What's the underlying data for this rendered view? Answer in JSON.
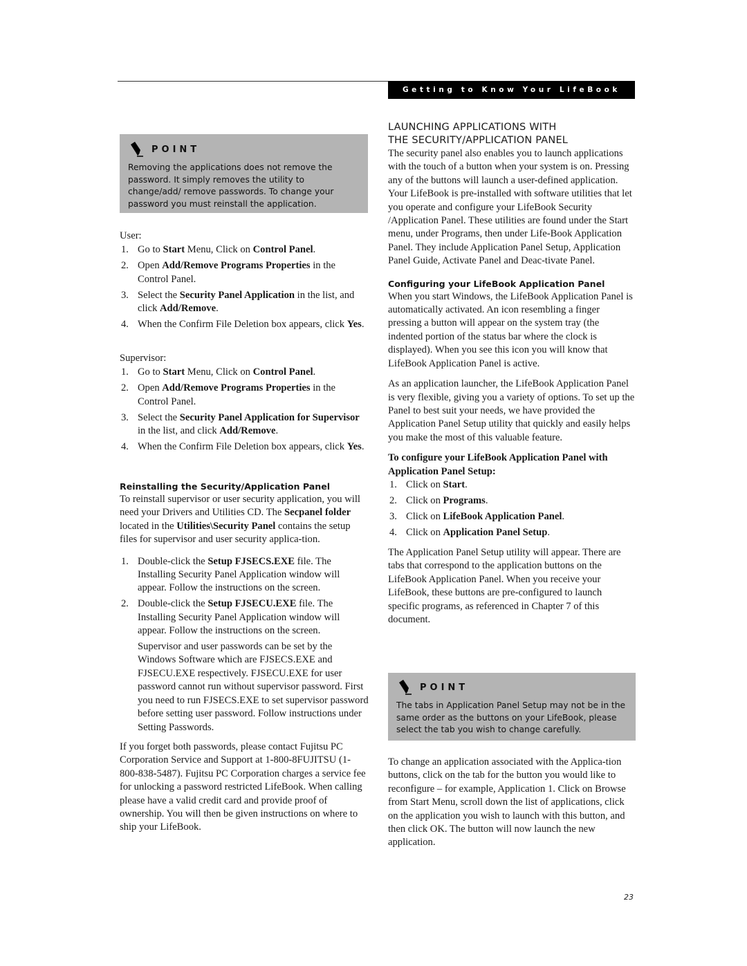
{
  "header": {
    "section_title": "Getting to Know Your LifeBook"
  },
  "left_column": {
    "point_box": {
      "label": "POINT",
      "icon": "pencil-icon",
      "text": "Removing the applications does not remove the password. It simply removes the utility to change/add/ remove passwords. To change your password you must reinstall the application."
    },
    "user": {
      "heading": "User:",
      "steps": [
        {
          "num": "1.",
          "parts": [
            [
              "Go to ",
              0
            ],
            [
              "Start",
              1
            ],
            [
              " Menu, Click on ",
              0
            ],
            [
              "Control Panel",
              1
            ],
            [
              ".",
              0
            ]
          ]
        },
        {
          "num": "2.",
          "parts": [
            [
              "Open ",
              0
            ],
            [
              "Add/Remove Programs Properties",
              1
            ],
            [
              " in the Control Panel.",
              0
            ]
          ]
        },
        {
          "num": "3.",
          "parts": [
            [
              "Select the ",
              0
            ],
            [
              "Security Panel Application",
              1
            ],
            [
              " in the list, and click ",
              0
            ],
            [
              "Add/Remove",
              1
            ],
            [
              ".",
              0
            ]
          ]
        },
        {
          "num": "4.",
          "parts": [
            [
              "When the Confirm File Deletion box appears, click ",
              0
            ],
            [
              "Yes",
              1
            ],
            [
              ".",
              0
            ]
          ]
        }
      ]
    },
    "supervisor": {
      "heading": "Supervisor:",
      "steps": [
        {
          "num": "1.",
          "parts": [
            [
              "Go to ",
              0
            ],
            [
              "Start",
              1
            ],
            [
              " Menu, Click on ",
              0
            ],
            [
              "Control Panel",
              1
            ],
            [
              ".",
              0
            ]
          ]
        },
        {
          "num": "2.",
          "parts": [
            [
              "Open ",
              0
            ],
            [
              "Add/Remove Programs Properties",
              1
            ],
            [
              " in the Control Panel.",
              0
            ]
          ]
        },
        {
          "num": "3.",
          "parts": [
            [
              "Select the ",
              0
            ],
            [
              "Security Panel Application for Supervisor",
              1
            ],
            [
              " in the list, and click ",
              0
            ],
            [
              "Add/Remove",
              1
            ],
            [
              ".",
              0
            ]
          ]
        },
        {
          "num": "4.",
          "parts": [
            [
              "When the Confirm File Deletion box appears, click ",
              0
            ],
            [
              "Yes",
              1
            ],
            [
              ".",
              0
            ]
          ]
        }
      ]
    },
    "reinstall": {
      "heading": "Reinstalling the Security/Application Panel",
      "intro_parts": [
        [
          "To reinstall supervisor or user security application, you will need your Drivers and Utilities CD. The ",
          0
        ],
        [
          "Secpanel folder",
          1
        ],
        [
          " located in the ",
          0
        ],
        [
          "Utilities\\Security Panel",
          1
        ],
        [
          " contains the setup files for supervisor and user security applica-tion.",
          0
        ]
      ],
      "steps": [
        {
          "num": "1.",
          "parts": [
            [
              "Double-click the ",
              0
            ],
            [
              "Setup FJSECS.EXE",
              1
            ],
            [
              " file. The Installing Security Panel Application window will appear. Follow the instructions on the screen.",
              0
            ]
          ]
        },
        {
          "num": "2.",
          "parts": [
            [
              "Double-click the ",
              0
            ],
            [
              "Setup FJSECU.EXE",
              1
            ],
            [
              " file. The Installing Security Panel Application window will appear. Follow the instructions on the screen.",
              0
            ]
          ]
        }
      ],
      "note": "Supervisor and user passwords can be set by the Windows Software which are FJSECS.EXE and FJSECU.EXE respectively. FJSECU.EXE for user password cannot run without supervisor password. First you need to run FJSECS.EXE to set supervisor password before setting user password. Follow instructions under Setting Passwords.",
      "contact": "If you forget both passwords, please contact Fujitsu PC Corporation Service and Support at 1-800-8FUJITSU (1-800-838-5487).  Fujitsu PC Corporation charges a service fee for unlocking a password restricted LifeBook. When calling please have a valid credit card and provide proof of ownership. You will then be given instructions on where to ship your LifeBook."
    }
  },
  "right_column": {
    "main_heading_line1": "LAUNCHING APPLICATIONS WITH",
    "main_heading_line2": "THE SECURITY/APPLICATION PANEL",
    "intro": "The security panel also enables you to launch applications with the touch of a button when your system is on. Pressing any of the buttons will launch a user-defined application. Your LifeBook is pre-installed with software utilities that let you operate and configure your LifeBook Security /Application Panel. These utilities are found under the Start menu, under Programs, then under Life-Book Application Panel. They include Application Panel Setup, Application Panel Guide, Activate Panel and Deac-tivate Panel.",
    "configuring": {
      "heading": "Configuring your LifeBook Application Panel",
      "para1": "When you start Windows, the LifeBook Application Panel is automatically activated. An icon resembling a finger pressing a button will appear on the system tray (the indented portion of the status bar where the clock is displayed). When you see this icon you will know that LifeBook Application Panel is active.",
      "para2": "As an application launcher, the LifeBook Application Panel is very flexible, giving you a variety of options. To set up the Panel to best suit your needs, we have provided the Application Panel Setup utility that quickly and easily helps you make the most of this valuable feature.",
      "steps_heading": "To configure your LifeBook Application Panel with Application Panel Setup:",
      "steps": [
        {
          "num": "1.",
          "parts": [
            [
              "Click on ",
              0
            ],
            [
              "Start",
              1
            ],
            [
              ".",
              0
            ]
          ]
        },
        {
          "num": "2.",
          "parts": [
            [
              "Click on ",
              0
            ],
            [
              "Programs",
              1
            ],
            [
              ".",
              0
            ]
          ]
        },
        {
          "num": "3.",
          "parts": [
            [
              "Click on ",
              0
            ],
            [
              "LifeBook Application Panel",
              1
            ],
            [
              ".",
              0
            ]
          ]
        },
        {
          "num": "4.",
          "parts": [
            [
              "Click on ",
              0
            ],
            [
              "Application Panel Setup",
              1
            ],
            [
              ".",
              0
            ]
          ]
        }
      ],
      "para3": "The Application Panel Setup utility will appear. There are tabs that correspond to the application buttons on the LifeBook Application Panel.  When you receive your LifeBook, these buttons are pre-configured to launch specific programs, as referenced in Chapter 7 of this document."
    },
    "point_box": {
      "label": "POINT",
      "icon": "pencil-icon",
      "text": "The tabs in Application Panel Setup may not be in the same order as the buttons on your LifeBook, please select the tab you wish to change carefully."
    },
    "closing": "To change an application associated with the Applica-tion buttons, click on the tab for the button you would like to reconfigure – for example, Application 1. Click on Browse from Start Menu, scroll down the list of applications, click on the application you wish to launch with this button, and then click OK. The button will now launch the new application."
  },
  "footer": {
    "page_number": "23"
  }
}
